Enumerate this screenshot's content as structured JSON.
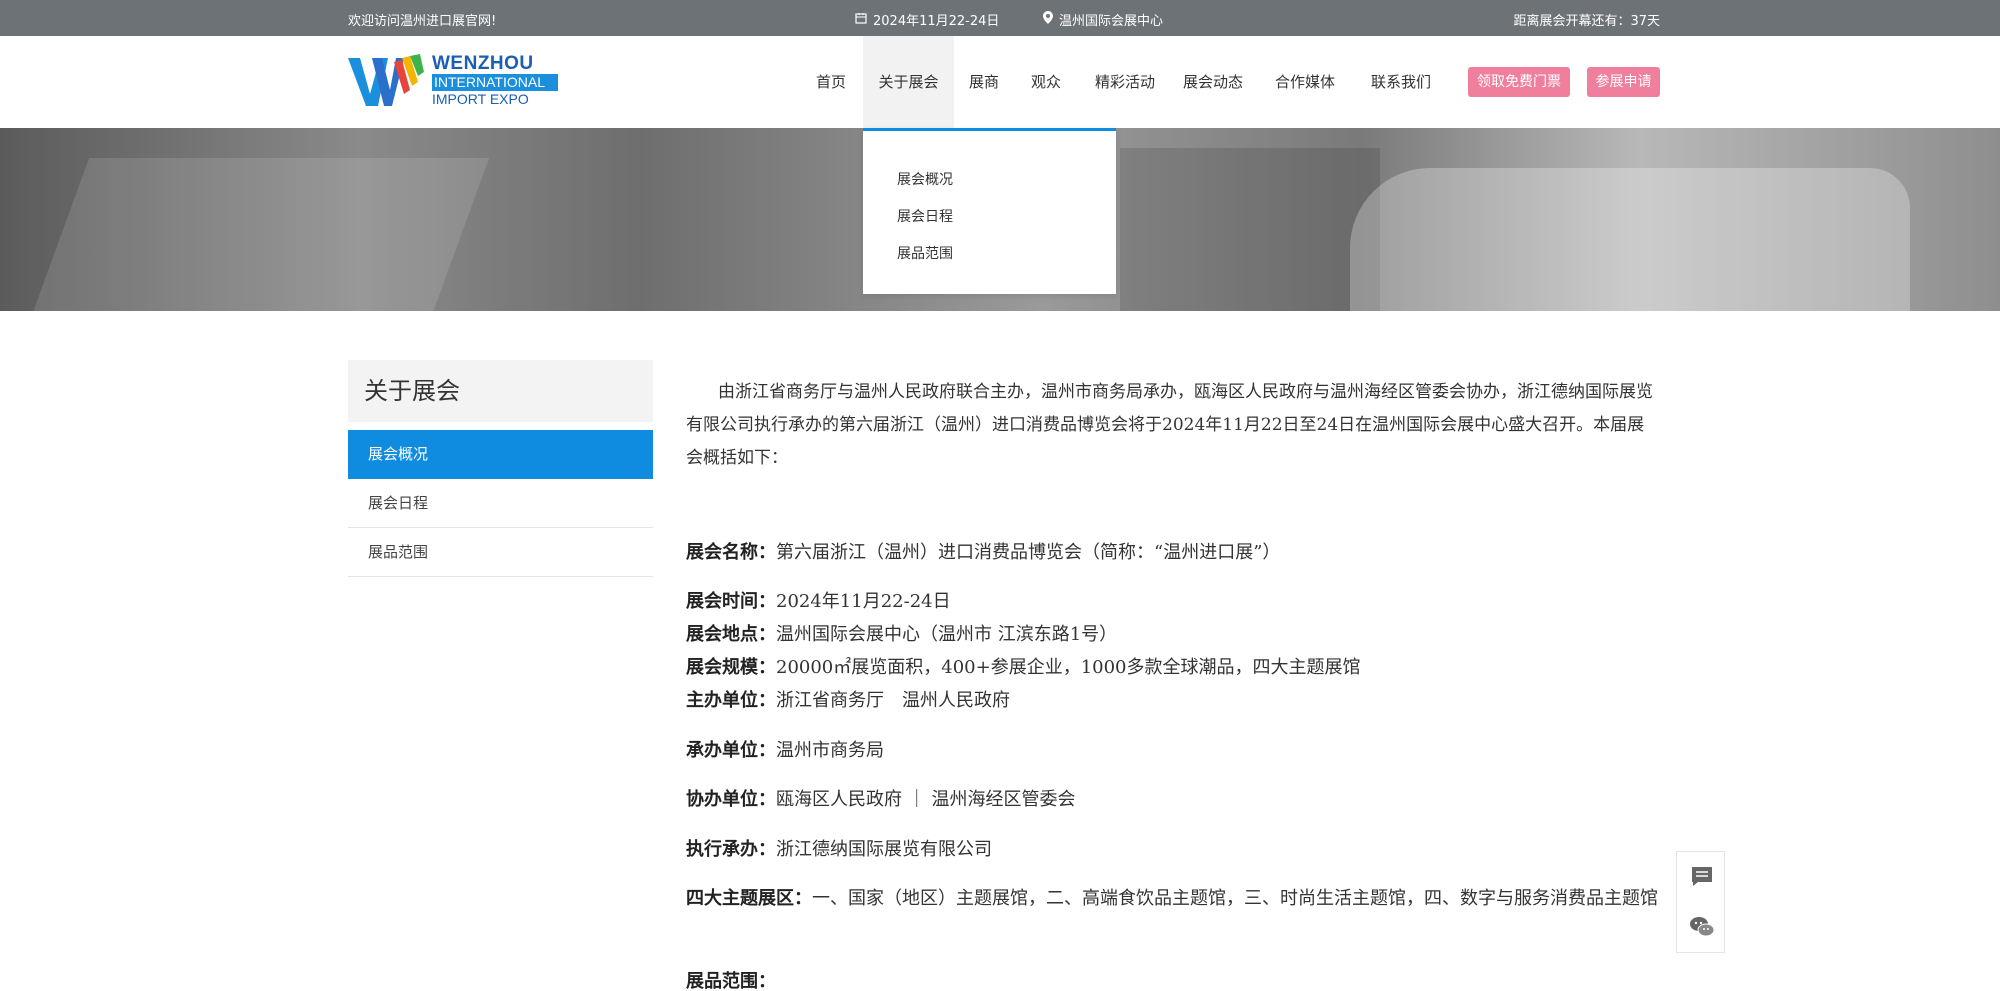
{
  "topbar": {
    "welcome": "欢迎访问温州进口展官网!",
    "date": "2024年11月22-24日",
    "location": "温州国际会展中心",
    "countdown": "距离展会开幕还有：37天",
    "date_icon": "calendar-icon",
    "location_icon": "map-pin-icon"
  },
  "logo": {
    "line1": "WENZHOU",
    "line2": "INTERNATIONAL",
    "line3": "IMPORT EXPO"
  },
  "nav": {
    "items": [
      {
        "label": "首页"
      },
      {
        "label": "关于展会"
      },
      {
        "label": "展商"
      },
      {
        "label": "观众"
      },
      {
        "label": "精彩活动"
      },
      {
        "label": "展会动态"
      },
      {
        "label": "合作媒体"
      },
      {
        "label": "联系我们"
      }
    ],
    "ticket_button": "领取免费门票",
    "exhibit_button": "参展申请"
  },
  "dropdown": {
    "items": [
      "展会概况",
      "展会日程",
      "展品范围"
    ]
  },
  "sidebar": {
    "title": "关于展会",
    "items": [
      "展会概况",
      "展会日程",
      "展品范围"
    ]
  },
  "content": {
    "intro": "由浙江省商务厅与温州人民政府联合主办，温州市商务局承办，瓯海区人民政府与温州海经区管委会协办，浙江德纳国际展览有限公司执行承办的第六届浙江（温州）进口消费品博览会将于2024年11月22日至24日在温州国际会展中心盛大召开。本届展会概括如下：",
    "rows": [
      {
        "k": "展会名称：",
        "v": "第六届浙江（温州）进口消费品博览会（简称：“温州进口展”）"
      },
      {
        "k": "展会时间：",
        "v": "2024年11月22-24日"
      },
      {
        "k": "展会地点：",
        "v": "温州国际会展中心（温州市 江滨东路1号）"
      },
      {
        "k": "展会规模：",
        "v": "20000㎡展览面积，400+参展企业，1000多款全球潮品，四大主题展馆"
      },
      {
        "k": "主办单位：",
        "v": "浙江省商务厅　温州人民政府"
      },
      {
        "k": "承办单位：",
        "v": "温州市商务局"
      },
      {
        "k": "协办单位：",
        "v": "瓯海区人民政府 ｜ 温州海经区管委会"
      },
      {
        "k": "执行承办：",
        "v": "浙江德纳国际展览有限公司"
      },
      {
        "k": "四大主题展区：",
        "v": "一、国家（地区）主题展馆，二、高端食饮品主题馆，三、时尚生活主题馆，四、数字与服务消费品主题馆"
      },
      {
        "k": "展品范围：",
        "v": ""
      }
    ]
  },
  "float": {
    "message_icon": "message-icon",
    "wechat_icon": "wechat-icon"
  },
  "colors": {
    "topbar": "#6d7276",
    "accent": "#0f8ce0",
    "button": "#ef7f9c"
  }
}
